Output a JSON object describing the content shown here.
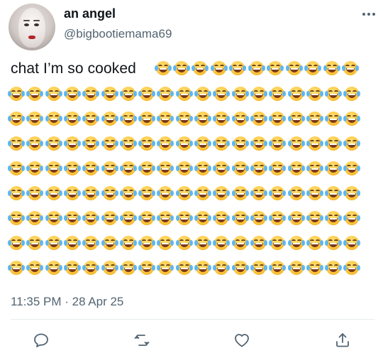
{
  "author": {
    "display_name": "an angel",
    "handle": "@bigbootiemama69",
    "avatar_icon": "avatar-photo",
    "more_icon": "more-options-icon"
  },
  "tweet": {
    "text": "chat I’m so cooked",
    "emoji": "😂",
    "emoji_name": "face-with-tears-of-joy",
    "emoji_count": 163,
    "timestamp": "11:35 PM · 28 Apr 25"
  },
  "actions": [
    {
      "name": "reply",
      "icon": "reply-icon"
    },
    {
      "name": "retweet",
      "icon": "retweet-icon"
    },
    {
      "name": "like",
      "icon": "heart-icon"
    },
    {
      "name": "share",
      "icon": "share-icon"
    }
  ],
  "colors": {
    "text": "#0f1419",
    "secondary": "#536471",
    "divider": "#e6ecf0",
    "emoji_yellow": "#fcc43a",
    "tears_blue": "#5fb6f0"
  }
}
